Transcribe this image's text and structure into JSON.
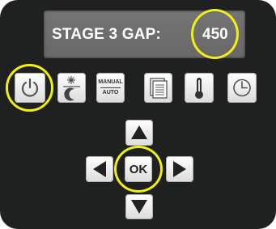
{
  "display": {
    "label": "STAGE 3 GAP:",
    "value": "450"
  },
  "buttons": {
    "power": "power-icon",
    "day_night": "sun-moon-icon",
    "manual_auto": {
      "top": "MANUAL",
      "bottom": "AUTO"
    },
    "menu": "document-list-icon",
    "temperature": "thermometer-icon",
    "clock": "clock-icon",
    "ok": "OK"
  },
  "colors": {
    "panel": "#1f2020",
    "display": "#6e6e6e",
    "highlight": "#f2ef12"
  }
}
